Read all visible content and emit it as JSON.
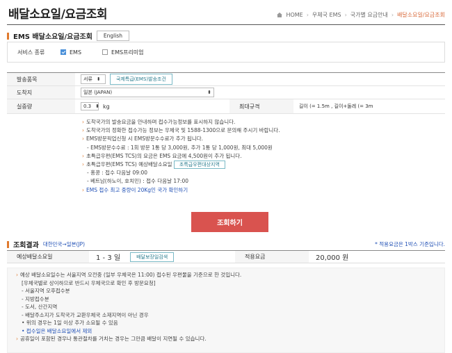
{
  "page_title": "배달소요일/요금조회",
  "breadcrumb": [
    "HOME",
    "우체국 EMS",
    "국가별 요금안내",
    "배달소요일/요금조회"
  ],
  "section1": {
    "title": "EMS 배달소요일/요금조회",
    "english_button": "English",
    "service_label": "서비스 종류",
    "options": [
      {
        "label": "EMS",
        "checked": true
      },
      {
        "label": "EMS프리미엄",
        "checked": false
      }
    ]
  },
  "form": {
    "item_label": "발송품목",
    "item_value": "서류",
    "item_button": "국제특급(EMS)발송조건",
    "dest_label": "도착지",
    "dest_value": "일본 (JAPAN)",
    "weight_label": "실중량",
    "weight_value": "0.3",
    "weight_unit": "kg",
    "maxsize_label": "최대규격",
    "maxsize_value": "길이 (= 1.5m , 길이+둘레 (= 3m"
  },
  "notes": [
    "도착국가의 발송요금을 안내하며 접수가능정보를 표시하지 않습니다.",
    "도착국가의 정확한 접수가능 정보는 우체국 및 1588-1300으로 문의해 주시기 바랍니다.",
    "EMS방문픽업신청 시 EMS방문수수료가 추가 됩니다.",
    "- EMS방문수수료 : 1회 방문 1통 당 3,000원, 추가 1통 당 1,000원, 최대 5,000원",
    "초특급우편(EMS TCS)의 요금은 EMS 요금에 4,500원이 추가 됩니다.",
    "초특급우편(EMS TCS) 예상배달소요일",
    "- 홍콩 : 접수 다음날 09:00",
    "- 베트남(하노이, 호치민) : 접수 다음날 17:00",
    "EMS 접수 최고 중량이 20Kg인 국가 확인하기"
  ],
  "tcs_button": "초특급우편대상지역",
  "submit_button": "조회하기",
  "result": {
    "title": "조회결과",
    "route": "대한민국→일본(JP)",
    "note": "* 적용요금은 1박스 기준입니다.",
    "days_label": "예상배달소요일",
    "days_value": "1 - 3 일",
    "days_button": "배달보장일검색",
    "fee_label": "적용요금",
    "fee_value": "20,000 원"
  },
  "result_notes": [
    "예상 배달소요일수는 서울지역 오전중 (일부 우체국은 11:00) 접수된 우편물을 기준으로 한 것입니다.",
    "[우체국별로 상이하므로 반드시 우체국으로 확인 후 방문요청]",
    "- 서울지역 오후접수분",
    "- 지방접수분",
    "- 도서, 산간지역",
    "- 배달주소지가 도착국가 교환우체국 소재지역이 아닌 경우",
    "• 위의 경우는 1일 이상 추가 소요될 수 있음",
    "• 접수일은 배달소요일에서 제외",
    "공휴일이 포함된 경우나 통관절차를 거치는 경우는 그만큼 배달이 지연될 수 있습니다."
  ],
  "colors": {
    "accent": "#e07a2e",
    "button_red": "#d9534f",
    "link_blue": "#1f4fb5"
  }
}
